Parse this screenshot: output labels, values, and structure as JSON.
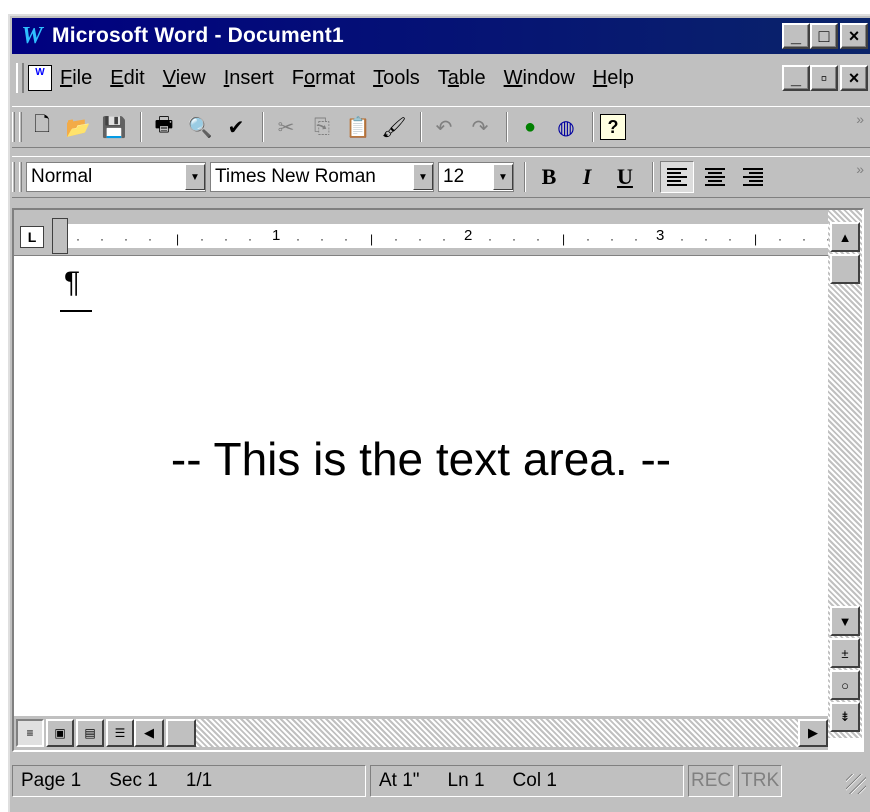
{
  "window": {
    "title": "Microsoft Word - Document1",
    "app_icon": "W",
    "controls": [
      "_",
      "□",
      "×"
    ]
  },
  "menubar": {
    "items": [
      {
        "label": "File",
        "accel": "F"
      },
      {
        "label": "Edit",
        "accel": "E"
      },
      {
        "label": "View",
        "accel": "V"
      },
      {
        "label": "Insert",
        "accel": "I"
      },
      {
        "label": "Format",
        "accel": "o"
      },
      {
        "label": "Tools",
        "accel": "T"
      },
      {
        "label": "Table",
        "accel": "a"
      },
      {
        "label": "Window",
        "accel": "W"
      },
      {
        "label": "Help",
        "accel": "H"
      }
    ],
    "doc_controls": [
      "_",
      "▫",
      "×"
    ]
  },
  "standard_toolbar": {
    "icons": [
      "new-document-icon",
      "open-folder-icon",
      "save-icon",
      "print-icon",
      "print-preview-icon",
      "spelling-icon",
      "cut-icon",
      "copy-icon",
      "paste-icon",
      "format-painter-icon",
      "undo-icon",
      "redo-icon",
      "web-toolbar-icon",
      "web-globe-icon",
      "help-icon"
    ],
    "glyphs": {
      "new": "🗋",
      "open": "📂",
      "save": "💾",
      "print": "🖶",
      "preview": "🔍",
      "spell": "✔",
      "cut": "✂",
      "copy": "⎘",
      "paste": "📋",
      "painter": "🖌",
      "undo": "↶",
      "redo": "↷",
      "web": "●",
      "globe": "◍",
      "help": "?"
    },
    "overflow": "»"
  },
  "formatting_toolbar": {
    "style": "Normal",
    "font": "Times New Roman",
    "size": "12",
    "bold": "B",
    "italic": "I",
    "underline": "U",
    "overflow": "»",
    "align_active": "left"
  },
  "ruler": {
    "tab_marker": "L",
    "numbers": [
      "1",
      "2",
      "3"
    ]
  },
  "document": {
    "paragraph_mark": "¶",
    "caption": "-- This is the text area. --"
  },
  "statusbar": {
    "page": "Page 1",
    "section": "Sec 1",
    "pages": "1/1",
    "at": "At 1\"",
    "line": "Ln 1",
    "col": "Col 1",
    "rec": "REC",
    "trk": "TRK"
  },
  "colors": {
    "titlebar": "#000080",
    "chrome": "#c0c0c0"
  }
}
